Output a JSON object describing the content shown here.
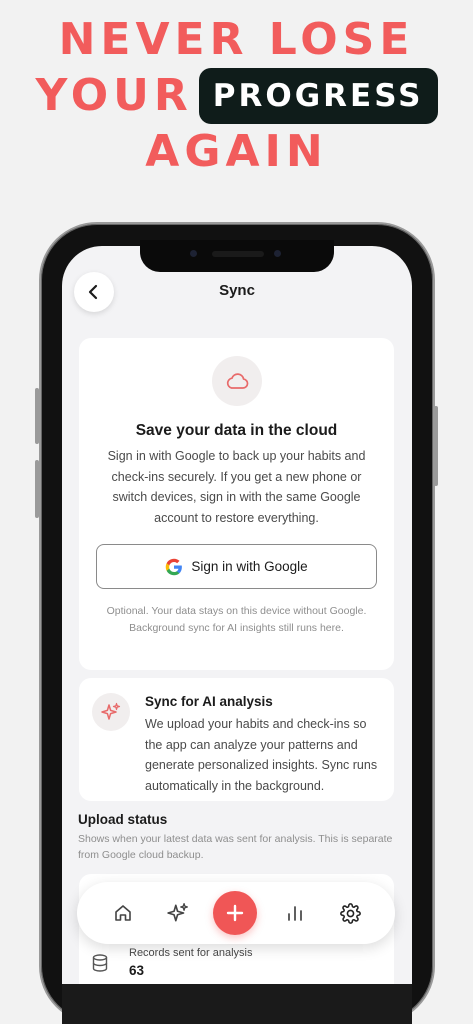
{
  "headline": {
    "line1": "NEVER LOSE",
    "line2_plain": "YOUR",
    "line2_highlight": "PROGRESS",
    "line3": "AGAIN",
    "accent_color": "#f25c5c",
    "pill_color": "#0f1c1a"
  },
  "header": {
    "back_icon": "chevron-left-icon",
    "title": "Sync"
  },
  "cloud_card": {
    "icon": "cloud-icon",
    "title": "Save your data in the cloud",
    "body": "Sign in with Google to back up your habits and check-ins securely. If you get a new phone or switch devices, sign in with the same Google account to restore everything.",
    "google_button_label": "Sign in with Google",
    "note": "Optional. Your data stays on this device without Google. Background sync for AI insights still runs here."
  },
  "ai_card": {
    "icon": "sparkle-icon",
    "title": "Sync for AI analysis",
    "body": "We upload your habits and check-ins so the app can analyze your patterns and generate personalized insights. Sync runs automatically in the background."
  },
  "upload_status": {
    "title": "Upload status",
    "description": "Shows when your latest data was sent for analysis. This is separate from Google cloud backup.",
    "records_label": "Records sent for analysis",
    "records_value": "63",
    "records_icon": "database-icon"
  },
  "bottom_nav": {
    "items": [
      "home-icon",
      "sparkle-icon",
      "add-icon",
      "chart-icon",
      "gear-icon"
    ],
    "fab_color": "#f05656"
  }
}
